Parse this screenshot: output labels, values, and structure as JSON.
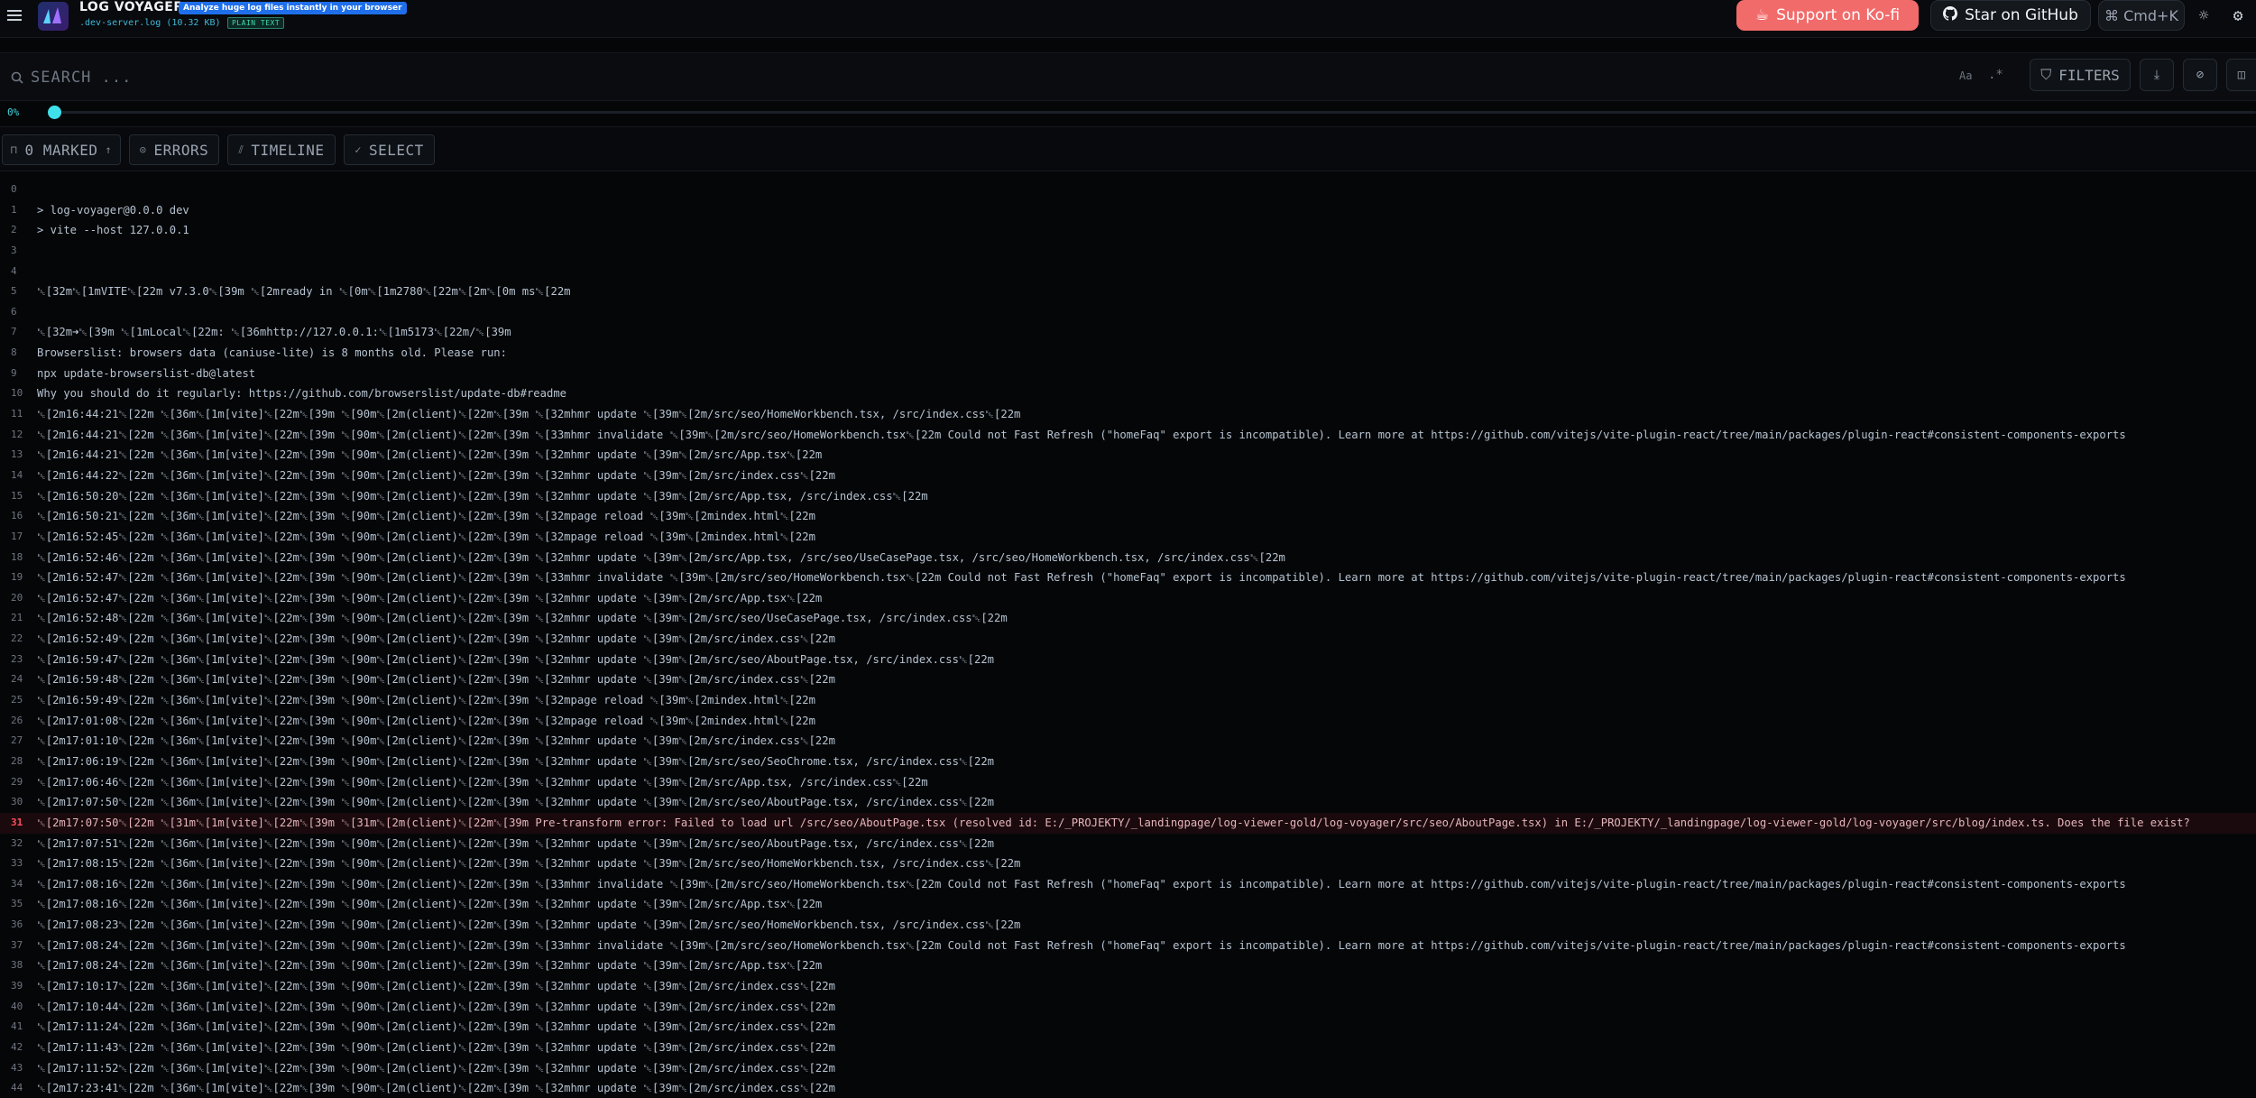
{
  "app": {
    "title": "LOG VOYAGER",
    "tagline": "Analyze huge log files instantly in your browser",
    "file_name": ".dev-server.log (10.32 KB)",
    "file_type": "PLAIN TEXT"
  },
  "header": {
    "kofi_label": "Support on Ko-fi",
    "github_label": "Star on GitHub",
    "cmdk_label": "⌘ Cmd+K"
  },
  "search": {
    "placeholder": "SEARCH ...",
    "value": "",
    "case_label": "Aa",
    "regex_label": ".*",
    "filters_label": "FILTERS"
  },
  "progress": {
    "percent_label": "0%",
    "value": 0
  },
  "toolbar": {
    "marked_label": "0 MARKED",
    "errors_label": "ERRORS",
    "timeline_label": "TIMELINE",
    "select_label": "SELECT"
  },
  "colors": {
    "accent": "#3fe0ea",
    "kofi": "#f26b6b",
    "error": "#ff4d5e",
    "tagline_bg": "#1f6feb"
  },
  "log_lines": [
    {
      "n": "0",
      "text": "",
      "level": "info"
    },
    {
      "n": "1",
      "text": "> log-voyager@0.0.0 dev",
      "level": "info"
    },
    {
      "n": "2",
      "text": "> vite --host 127.0.0.1",
      "level": "info"
    },
    {
      "n": "3",
      "text": "",
      "level": "info"
    },
    {
      "n": "4",
      "text": "",
      "level": "info"
    },
    {
      "n": "5",
      "text": "  ␛[32m␛[1mVITE␛[22m v7.3.0␛[39m  ␛[2mready in ␛[0m␛[1m2780␛[22m␛[2m␛[0m ms␛[22m",
      "level": "info"
    },
    {
      "n": "6",
      "text": "",
      "level": "info"
    },
    {
      "n": "7",
      "text": "  ␛[32m➜␛[39m  ␛[1mLocal␛[22m:   ␛[36mhttp://127.0.0.1:␛[1m5173␛[22m/␛[39m",
      "level": "info"
    },
    {
      "n": "8",
      "text": "Browserslist: browsers data (caniuse-lite) is 8 months old. Please run:",
      "level": "info"
    },
    {
      "n": "9",
      "text": "  npx update-browserslist-db@latest",
      "level": "info"
    },
    {
      "n": "10",
      "text": "  Why you should do it regularly: https://github.com/browserslist/update-db#readme",
      "level": "info"
    },
    {
      "n": "11",
      "text": "␛[2m16:44:21␛[22m ␛[36m␛[1m[vite]␛[22m␛[39m ␛[90m␛[2m(client)␛[22m␛[39m ␛[32mhmr update ␛[39m␛[2m/src/seo/HomeWorkbench.tsx, /src/index.css␛[22m",
      "level": "info"
    },
    {
      "n": "12",
      "text": "␛[2m16:44:21␛[22m ␛[36m␛[1m[vite]␛[22m␛[39m ␛[90m␛[2m(client)␛[22m␛[39m ␛[33mhmr invalidate ␛[39m␛[2m/src/seo/HomeWorkbench.tsx␛[22m Could not Fast Refresh (\"homeFaq\" export is incompatible). Learn more at https://github.com/vitejs/vite-plugin-react/tree/main/packages/plugin-react#consistent-components-exports",
      "level": "info"
    },
    {
      "n": "13",
      "text": "␛[2m16:44:21␛[22m ␛[36m␛[1m[vite]␛[22m␛[39m ␛[90m␛[2m(client)␛[22m␛[39m ␛[32mhmr update ␛[39m␛[2m/src/App.tsx␛[22m",
      "level": "info"
    },
    {
      "n": "14",
      "text": "␛[2m16:44:22␛[22m ␛[36m␛[1m[vite]␛[22m␛[39m ␛[90m␛[2m(client)␛[22m␛[39m ␛[32mhmr update ␛[39m␛[2m/src/index.css␛[22m",
      "level": "info"
    },
    {
      "n": "15",
      "text": "␛[2m16:50:20␛[22m ␛[36m␛[1m[vite]␛[22m␛[39m ␛[90m␛[2m(client)␛[22m␛[39m ␛[32mhmr update ␛[39m␛[2m/src/App.tsx, /src/index.css␛[22m",
      "level": "info"
    },
    {
      "n": "16",
      "text": "␛[2m16:50:21␛[22m ␛[36m␛[1m[vite]␛[22m␛[39m ␛[90m␛[2m(client)␛[22m␛[39m ␛[32mpage reload ␛[39m␛[2mindex.html␛[22m",
      "level": "info"
    },
    {
      "n": "17",
      "text": "␛[2m16:52:45␛[22m ␛[36m␛[1m[vite]␛[22m␛[39m ␛[90m␛[2m(client)␛[22m␛[39m ␛[32mpage reload ␛[39m␛[2mindex.html␛[22m",
      "level": "info"
    },
    {
      "n": "18",
      "text": "␛[2m16:52:46␛[22m ␛[36m␛[1m[vite]␛[22m␛[39m ␛[90m␛[2m(client)␛[22m␛[39m ␛[32mhmr update ␛[39m␛[2m/src/App.tsx, /src/seo/UseCasePage.tsx, /src/seo/HomeWorkbench.tsx, /src/index.css␛[22m",
      "level": "info"
    },
    {
      "n": "19",
      "text": "␛[2m16:52:47␛[22m ␛[36m␛[1m[vite]␛[22m␛[39m ␛[90m␛[2m(client)␛[22m␛[39m ␛[33mhmr invalidate ␛[39m␛[2m/src/seo/HomeWorkbench.tsx␛[22m Could not Fast Refresh (\"homeFaq\" export is incompatible). Learn more at https://github.com/vitejs/vite-plugin-react/tree/main/packages/plugin-react#consistent-components-exports",
      "level": "info"
    },
    {
      "n": "20",
      "text": "␛[2m16:52:47␛[22m ␛[36m␛[1m[vite]␛[22m␛[39m ␛[90m␛[2m(client)␛[22m␛[39m ␛[32mhmr update ␛[39m␛[2m/src/App.tsx␛[22m",
      "level": "info"
    },
    {
      "n": "21",
      "text": "␛[2m16:52:48␛[22m ␛[36m␛[1m[vite]␛[22m␛[39m ␛[90m␛[2m(client)␛[22m␛[39m ␛[32mhmr update ␛[39m␛[2m/src/seo/UseCasePage.tsx, /src/index.css␛[22m",
      "level": "info"
    },
    {
      "n": "22",
      "text": "␛[2m16:52:49␛[22m ␛[36m␛[1m[vite]␛[22m␛[39m ␛[90m␛[2m(client)␛[22m␛[39m ␛[32mhmr update ␛[39m␛[2m/src/index.css␛[22m",
      "level": "info"
    },
    {
      "n": "23",
      "text": "␛[2m16:59:47␛[22m ␛[36m␛[1m[vite]␛[22m␛[39m ␛[90m␛[2m(client)␛[22m␛[39m ␛[32mhmr update ␛[39m␛[2m/src/seo/AboutPage.tsx, /src/index.css␛[22m",
      "level": "info"
    },
    {
      "n": "24",
      "text": "␛[2m16:59:48␛[22m ␛[36m␛[1m[vite]␛[22m␛[39m ␛[90m␛[2m(client)␛[22m␛[39m ␛[32mhmr update ␛[39m␛[2m/src/index.css␛[22m",
      "level": "info"
    },
    {
      "n": "25",
      "text": "␛[2m16:59:49␛[22m ␛[36m␛[1m[vite]␛[22m␛[39m ␛[90m␛[2m(client)␛[22m␛[39m ␛[32mpage reload ␛[39m␛[2mindex.html␛[22m",
      "level": "info"
    },
    {
      "n": "26",
      "text": "␛[2m17:01:08␛[22m ␛[36m␛[1m[vite]␛[22m␛[39m ␛[90m␛[2m(client)␛[22m␛[39m ␛[32mpage reload ␛[39m␛[2mindex.html␛[22m",
      "level": "info"
    },
    {
      "n": "27",
      "text": "␛[2m17:01:10␛[22m ␛[36m␛[1m[vite]␛[22m␛[39m ␛[90m␛[2m(client)␛[22m␛[39m ␛[32mhmr update ␛[39m␛[2m/src/index.css␛[22m",
      "level": "info"
    },
    {
      "n": "28",
      "text": "␛[2m17:06:19␛[22m ␛[36m␛[1m[vite]␛[22m␛[39m ␛[90m␛[2m(client)␛[22m␛[39m ␛[32mhmr update ␛[39m␛[2m/src/seo/SeoChrome.tsx, /src/index.css␛[22m",
      "level": "info"
    },
    {
      "n": "29",
      "text": "␛[2m17:06:46␛[22m ␛[36m␛[1m[vite]␛[22m␛[39m ␛[90m␛[2m(client)␛[22m␛[39m ␛[32mhmr update ␛[39m␛[2m/src/App.tsx, /src/index.css␛[22m",
      "level": "info"
    },
    {
      "n": "30",
      "text": "␛[2m17:07:50␛[22m ␛[36m␛[1m[vite]␛[22m␛[39m ␛[90m␛[2m(client)␛[22m␛[39m ␛[32mhmr update ␛[39m␛[2m/src/seo/AboutPage.tsx, /src/index.css␛[22m",
      "level": "info"
    },
    {
      "n": "31",
      "text": "␛[2m17:07:50␛[22m ␛[31m␛[1m[vite]␛[22m␛[39m ␛[31m␛[2m(client)␛[22m␛[39m Pre-transform error: Failed to load url /src/seo/AboutPage.tsx (resolved id: E:/_PROJEKTY/_landingpage/log-viewer-gold/log-voyager/src/seo/AboutPage.tsx) in E:/_PROJEKTY/_landingpage/log-viewer-gold/log-voyager/src/blog/index.ts. Does the file exist?",
      "level": "error"
    },
    {
      "n": "32",
      "text": "␛[2m17:07:51␛[22m ␛[36m␛[1m[vite]␛[22m␛[39m ␛[90m␛[2m(client)␛[22m␛[39m ␛[32mhmr update ␛[39m␛[2m/src/seo/AboutPage.tsx, /src/index.css␛[22m",
      "level": "info"
    },
    {
      "n": "33",
      "text": "␛[2m17:08:15␛[22m ␛[36m␛[1m[vite]␛[22m␛[39m ␛[90m␛[2m(client)␛[22m␛[39m ␛[32mhmr update ␛[39m␛[2m/src/seo/HomeWorkbench.tsx, /src/index.css␛[22m",
      "level": "info"
    },
    {
      "n": "34",
      "text": "␛[2m17:08:16␛[22m ␛[36m␛[1m[vite]␛[22m␛[39m ␛[90m␛[2m(client)␛[22m␛[39m ␛[33mhmr invalidate ␛[39m␛[2m/src/seo/HomeWorkbench.tsx␛[22m Could not Fast Refresh (\"homeFaq\" export is incompatible). Learn more at https://github.com/vitejs/vite-plugin-react/tree/main/packages/plugin-react#consistent-components-exports",
      "level": "info"
    },
    {
      "n": "35",
      "text": "␛[2m17:08:16␛[22m ␛[36m␛[1m[vite]␛[22m␛[39m ␛[90m␛[2m(client)␛[22m␛[39m ␛[32mhmr update ␛[39m␛[2m/src/App.tsx␛[22m",
      "level": "info"
    },
    {
      "n": "36",
      "text": "␛[2m17:08:23␛[22m ␛[36m␛[1m[vite]␛[22m␛[39m ␛[90m␛[2m(client)␛[22m␛[39m ␛[32mhmr update ␛[39m␛[2m/src/seo/HomeWorkbench.tsx, /src/index.css␛[22m",
      "level": "info"
    },
    {
      "n": "37",
      "text": "␛[2m17:08:24␛[22m ␛[36m␛[1m[vite]␛[22m␛[39m ␛[90m␛[2m(client)␛[22m␛[39m ␛[33mhmr invalidate ␛[39m␛[2m/src/seo/HomeWorkbench.tsx␛[22m Could not Fast Refresh (\"homeFaq\" export is incompatible). Learn more at https://github.com/vitejs/vite-plugin-react/tree/main/packages/plugin-react#consistent-components-exports",
      "level": "info"
    },
    {
      "n": "38",
      "text": "␛[2m17:08:24␛[22m ␛[36m␛[1m[vite]␛[22m␛[39m ␛[90m␛[2m(client)␛[22m␛[39m ␛[32mhmr update ␛[39m␛[2m/src/App.tsx␛[22m",
      "level": "info"
    },
    {
      "n": "39",
      "text": "␛[2m17:10:17␛[22m ␛[36m␛[1m[vite]␛[22m␛[39m ␛[90m␛[2m(client)␛[22m␛[39m ␛[32mhmr update ␛[39m␛[2m/src/index.css␛[22m",
      "level": "info"
    },
    {
      "n": "40",
      "text": "␛[2m17:10:44␛[22m ␛[36m␛[1m[vite]␛[22m␛[39m ␛[90m␛[2m(client)␛[22m␛[39m ␛[32mhmr update ␛[39m␛[2m/src/index.css␛[22m",
      "level": "info"
    },
    {
      "n": "41",
      "text": "␛[2m17:11:24␛[22m ␛[36m␛[1m[vite]␛[22m␛[39m ␛[90m␛[2m(client)␛[22m␛[39m ␛[32mhmr update ␛[39m␛[2m/src/index.css␛[22m",
      "level": "info"
    },
    {
      "n": "42",
      "text": "␛[2m17:11:43␛[22m ␛[36m␛[1m[vite]␛[22m␛[39m ␛[90m␛[2m(client)␛[22m␛[39m ␛[32mhmr update ␛[39m␛[2m/src/index.css␛[22m",
      "level": "info"
    },
    {
      "n": "43",
      "text": "␛[2m17:11:52␛[22m ␛[36m␛[1m[vite]␛[22m␛[39m ␛[90m␛[2m(client)␛[22m␛[39m ␛[32mhmr update ␛[39m␛[2m/src/index.css␛[22m",
      "level": "info"
    },
    {
      "n": "44",
      "text": "␛[2m17:23:41␛[22m ␛[36m␛[1m[vite]␛[22m␛[39m ␛[90m␛[2m(client)␛[22m␛[39m ␛[32mhmr update ␛[39m␛[2m/src/index.css␛[22m",
      "level": "info"
    }
  ]
}
